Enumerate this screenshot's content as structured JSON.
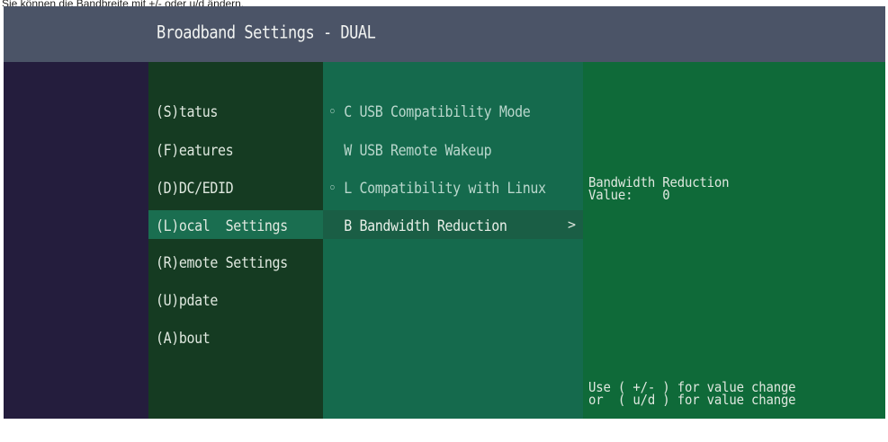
{
  "caption": "Sie können die Bandbreite mit +/- oder u/d ändern.",
  "window": {
    "title": "Broadband Settings - DUAL"
  },
  "main_menu": {
    "items": [
      {
        "label": "(S)tatus"
      },
      {
        "label": "(F)eatures"
      },
      {
        "label": "(D)DC/EDID"
      },
      {
        "label": "(L)ocal  Settings"
      },
      {
        "label": "(R)emote Settings"
      },
      {
        "label": "(U)pdate"
      },
      {
        "label": "(A)bout"
      }
    ],
    "selected_index": 3
  },
  "sub_menu": {
    "items": [
      {
        "label": "◦ C USB Compatibility Mode"
      },
      {
        "label": "  W USB Remote Wakeup"
      },
      {
        "label": "◦ L Compatibility with Linux"
      },
      {
        "label": "  B Bandwidth Reduction"
      }
    ],
    "selected_index": 3,
    "chevron": ">"
  },
  "detail": {
    "heading": "Bandwidth Reduction",
    "value_line": "Value:    0",
    "hint_1": "Use ( +/- ) for value change",
    "hint_2": "or  ( u/d ) for value change"
  },
  "colors": {
    "titlebar": "#4b5467",
    "left_strip": "#241d3d",
    "main_menu_bg": "#153b22",
    "sub_menu_bg": "#156a4d",
    "detail_bg": "#0f6a39",
    "selection": "#1a6e50"
  }
}
